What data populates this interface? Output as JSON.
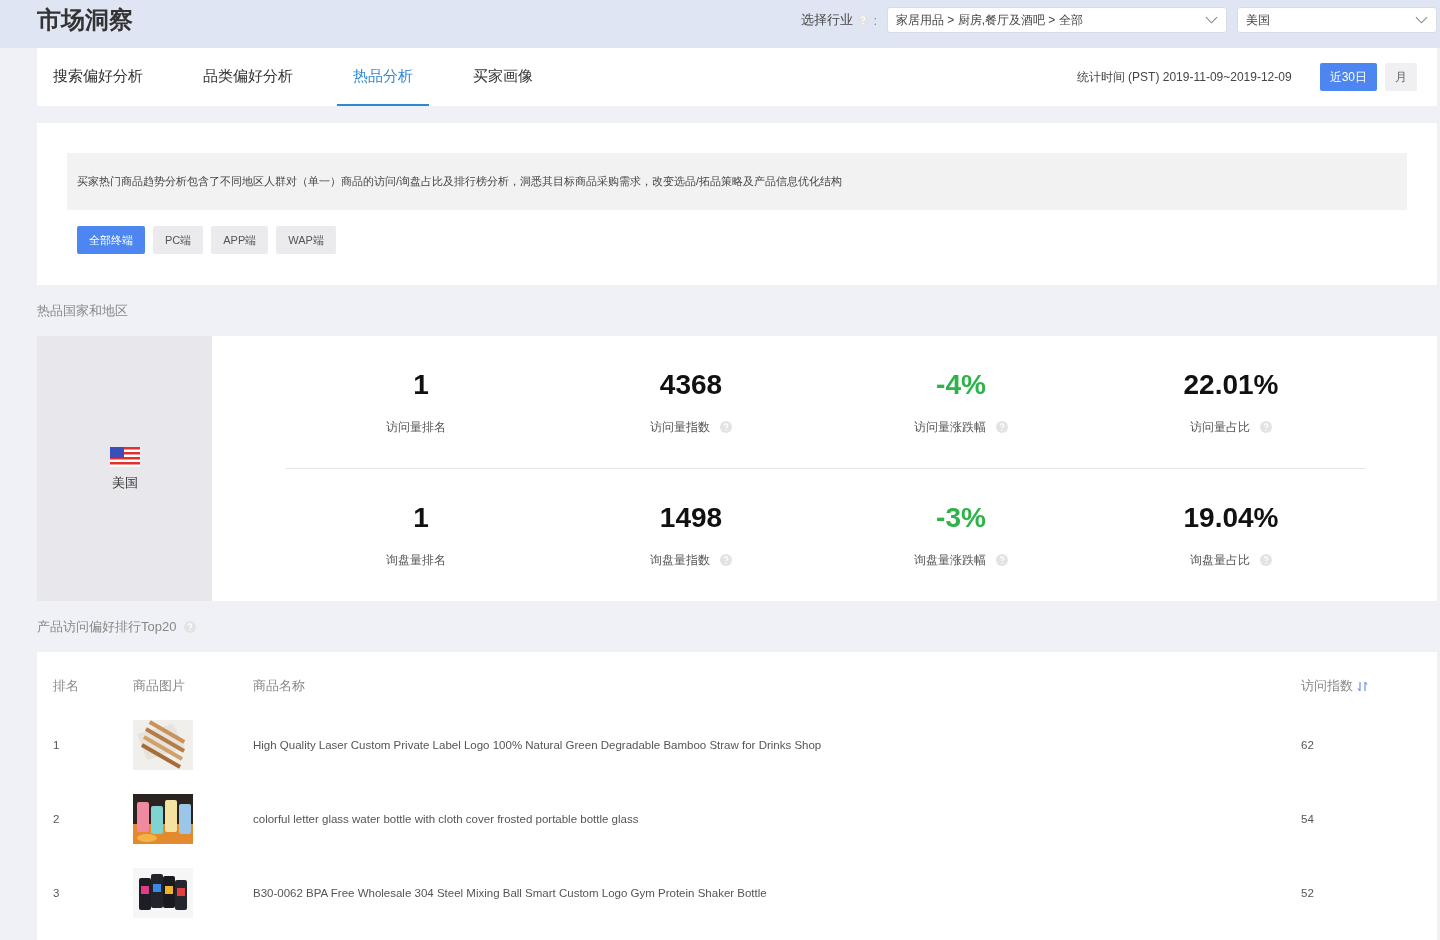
{
  "header": {
    "title": "市场洞察",
    "industry_label": "选择行业",
    "industry_colon": ":",
    "industry_select": {
      "value": "家居用品 > 厨房,餐厅及酒吧 > 全部"
    },
    "country_select": {
      "value": "美国"
    }
  },
  "tabs": [
    {
      "label": "搜索偏好分析",
      "selected": false
    },
    {
      "label": "品类偏好分析",
      "selected": false
    },
    {
      "label": "热品分析",
      "selected": true
    },
    {
      "label": "买家画像",
      "selected": false
    }
  ],
  "period": {
    "text": "统计时间 (PST) 2019-11-09~2019-12-09",
    "buttons": [
      {
        "label": "近30日",
        "selected": true
      },
      {
        "label": "月",
        "selected": false
      }
    ]
  },
  "intro": "买家热门商品趋势分析包含了不同地区人群对（单一）商品的访问/询盘占比及排行榜分析，洞悉其目标商品采购需求，改变选品/拓品策略及产品信息优化结构",
  "terminals": [
    {
      "label": "全部终端",
      "selected": true
    },
    {
      "label": "PC端",
      "selected": false
    },
    {
      "label": "APP端",
      "selected": false
    },
    {
      "label": "WAP端",
      "selected": false
    }
  ],
  "region_section": {
    "title": "热品国家和地区",
    "country": "美国",
    "stat_rows": [
      [
        {
          "value": "1",
          "label": "访问量排名",
          "help": false,
          "kind": "plain"
        },
        {
          "value": "4368",
          "label": "访问量指数",
          "help": true,
          "kind": "plain"
        },
        {
          "value": "-4%",
          "label": "访问量涨跌幅",
          "help": true,
          "kind": "change"
        },
        {
          "value": "22.01%",
          "label": "访问量占比",
          "help": true,
          "kind": "plain"
        }
      ],
      [
        {
          "value": "1",
          "label": "询盘量排名",
          "help": false,
          "kind": "plain"
        },
        {
          "value": "1498",
          "label": "询盘量指数",
          "help": true,
          "kind": "plain"
        },
        {
          "value": "-3%",
          "label": "询盘量涨跌幅",
          "help": true,
          "kind": "change"
        },
        {
          "value": "19.04%",
          "label": "询盘量占比",
          "help": true,
          "kind": "plain"
        }
      ]
    ]
  },
  "ranking": {
    "title": "产品访问偏好排行Top20",
    "columns": [
      {
        "label": "排名",
        "sortable": false
      },
      {
        "label": "商品图片",
        "sortable": false
      },
      {
        "label": "商品名称",
        "sortable": false
      },
      {
        "label": "访问指数",
        "sortable": true
      }
    ],
    "rows": [
      {
        "rank": "1",
        "name": "High Quality Laser Custom Private Label Logo 100% Natural Green Degradable Bamboo Straw for Drinks Shop",
        "index": "62"
      },
      {
        "rank": "2",
        "name": "colorful letter glass water bottle with cloth cover frosted portable bottle glass",
        "index": "54"
      },
      {
        "rank": "3",
        "name": "B30-0062 BPA Free Wholesale 304 Steel Mixing Ball Smart Custom Logo Gym Protein Shaker Bottle",
        "index": "52"
      }
    ]
  }
}
